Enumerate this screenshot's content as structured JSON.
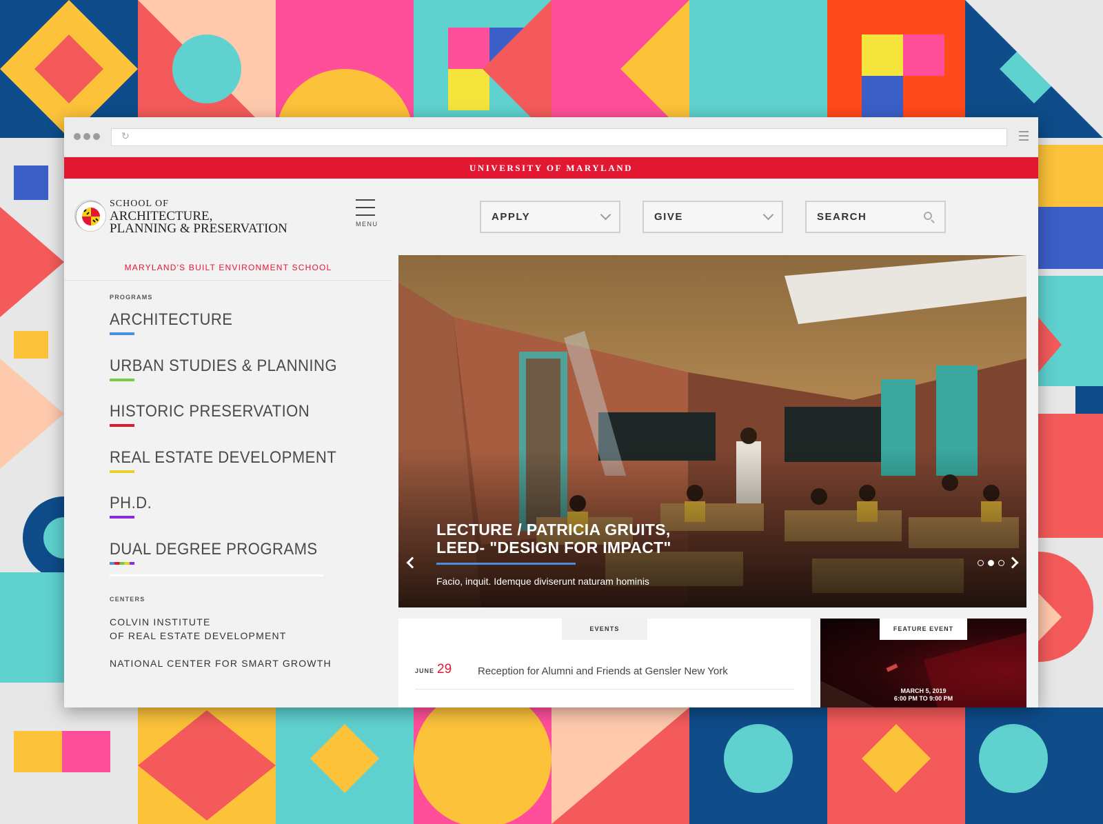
{
  "background": {
    "palette": [
      "#f45a5a",
      "#fcc23a",
      "#ff4f9a",
      "#5fd1cf",
      "#0e4c8a",
      "#ffc9ad",
      "#e7e7e7",
      "#3b5fc7",
      "#ff4a1c",
      "#f5e43c"
    ]
  },
  "umd_bar": {
    "label": "UNIVERSITY OF MARYLAND",
    "color": "#e21833"
  },
  "header": {
    "logo_line1": "SCHOOL OF",
    "logo_line2": "ARCHITECTURE,",
    "logo_line3": "PLANNING & PRESERVATION",
    "menu_label": "MENU",
    "apply_label": "APPLY",
    "give_label": "GIVE",
    "search_label": "SEARCH"
  },
  "sidebar": {
    "tagline": "MARYLAND'S BUILT ENVIRONMENT SCHOOL",
    "programs_heading": "PROGRAMS",
    "programs": [
      {
        "label": "ARCHITECTURE",
        "color": "#4a90e2"
      },
      {
        "label": "URBAN STUDIES & PLANNING",
        "color": "#7ac943"
      },
      {
        "label": "HISTORIC PRESERVATION",
        "color": "#e21833"
      },
      {
        "label": "REAL ESTATE DEVELOPMENT",
        "color": "#e8d22a"
      },
      {
        "label": "PH.D.",
        "color": "#8a2be2"
      },
      {
        "label": "DUAL DEGREE PROGRAMS",
        "color": "multi"
      }
    ],
    "centers_heading": "CENTERS",
    "centers": [
      {
        "line1": "COLVIN INSTITUTE",
        "line2": "OF REAL ESTATE DEVELOPMENT"
      },
      {
        "line1": "NATIONAL CENTER FOR SMART GROWTH"
      }
    ]
  },
  "hero": {
    "title_line1": "LECTURE / PATRICIA GRUITS,",
    "title_line2": "LEED- \"DESIGN FOR IMPACT\"",
    "subtitle": "Facio, inquit. Idemque diviserunt naturam hominis",
    "slide_count": 3,
    "active_slide": 2
  },
  "events": {
    "tab_label": "EVENTS",
    "items": [
      {
        "month": "JUNE",
        "day": "29",
        "title": "Reception for Alumni and Friends at Gensler New York"
      }
    ]
  },
  "feature_event": {
    "tab_label": "FEATURE EVENT",
    "date": "MARCH 5, 2019",
    "time": "6:00 PM TO 9:00 PM"
  }
}
